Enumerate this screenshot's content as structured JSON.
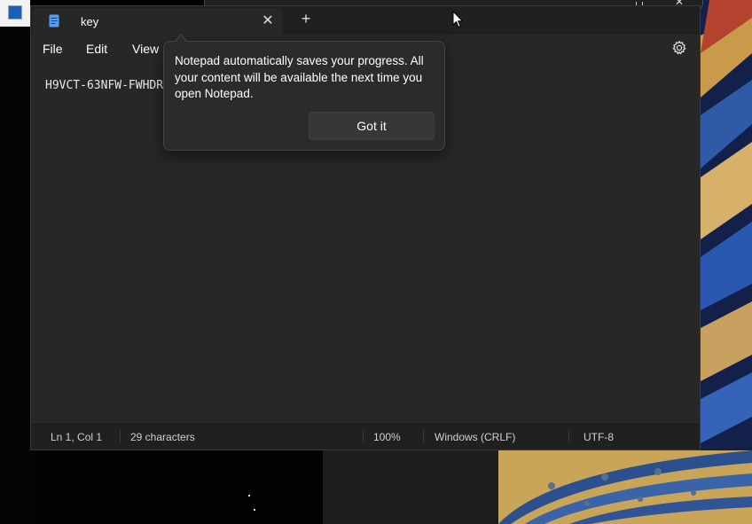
{
  "window": {
    "tab_title": "key",
    "tab_close_glyph": "✕",
    "new_tab_glyph": "+"
  },
  "menu": {
    "items": [
      "File",
      "Edit",
      "View"
    ]
  },
  "editor": {
    "content": "H9VCT-63NFW-FWHDR"
  },
  "tip": {
    "message": "Notepad automatically saves your progress. All your content will be available the next time you open Notepad.",
    "button_label": "Got it"
  },
  "status": {
    "position": "Ln 1, Col 1",
    "characters": "29 characters",
    "zoom": "100%",
    "line_endings": "Windows (CRLF)",
    "encoding": "UTF-8"
  },
  "overlay": {
    "close_glyph": "✕"
  },
  "colors": {
    "window_bg": "#272727",
    "tabbar_bg": "#202020",
    "accent_icon": "#4ea1f3"
  },
  "icons": [
    "notepad-icon",
    "close-icon",
    "plus-icon",
    "gear-icon",
    "maximize-icon",
    "mouse-cursor-icon"
  ]
}
